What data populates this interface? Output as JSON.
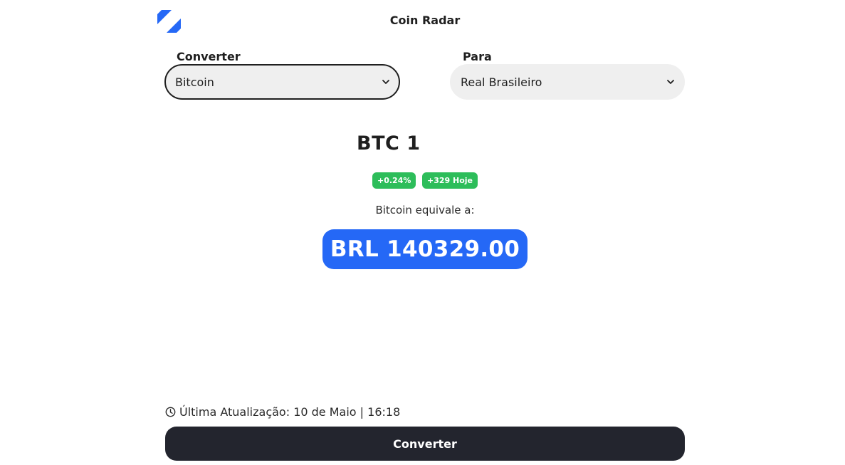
{
  "header": {
    "logo_icon": "stripes-logo-icon",
    "title": "Coin Radar"
  },
  "converter": {
    "from_label": "Converter",
    "from_value": "Bitcoin",
    "to_label": "Para",
    "to_value": "Real Brasileiro"
  },
  "result": {
    "amount_heading": "BTC 1",
    "change_percent": "+0.24%",
    "change_today": "+329 Hoje",
    "equivalence_text": "Bitcoin equivale a:",
    "converted_value": "BRL 140329.00"
  },
  "footer": {
    "last_update": "Última Atualização: 10 de Maio | 16:18",
    "convert_button_label": "Converter"
  },
  "colors": {
    "accent_blue": "#2568f6",
    "positive_green": "#2dbd5a",
    "button_dark": "#23252e",
    "select_background": "#efefef"
  }
}
